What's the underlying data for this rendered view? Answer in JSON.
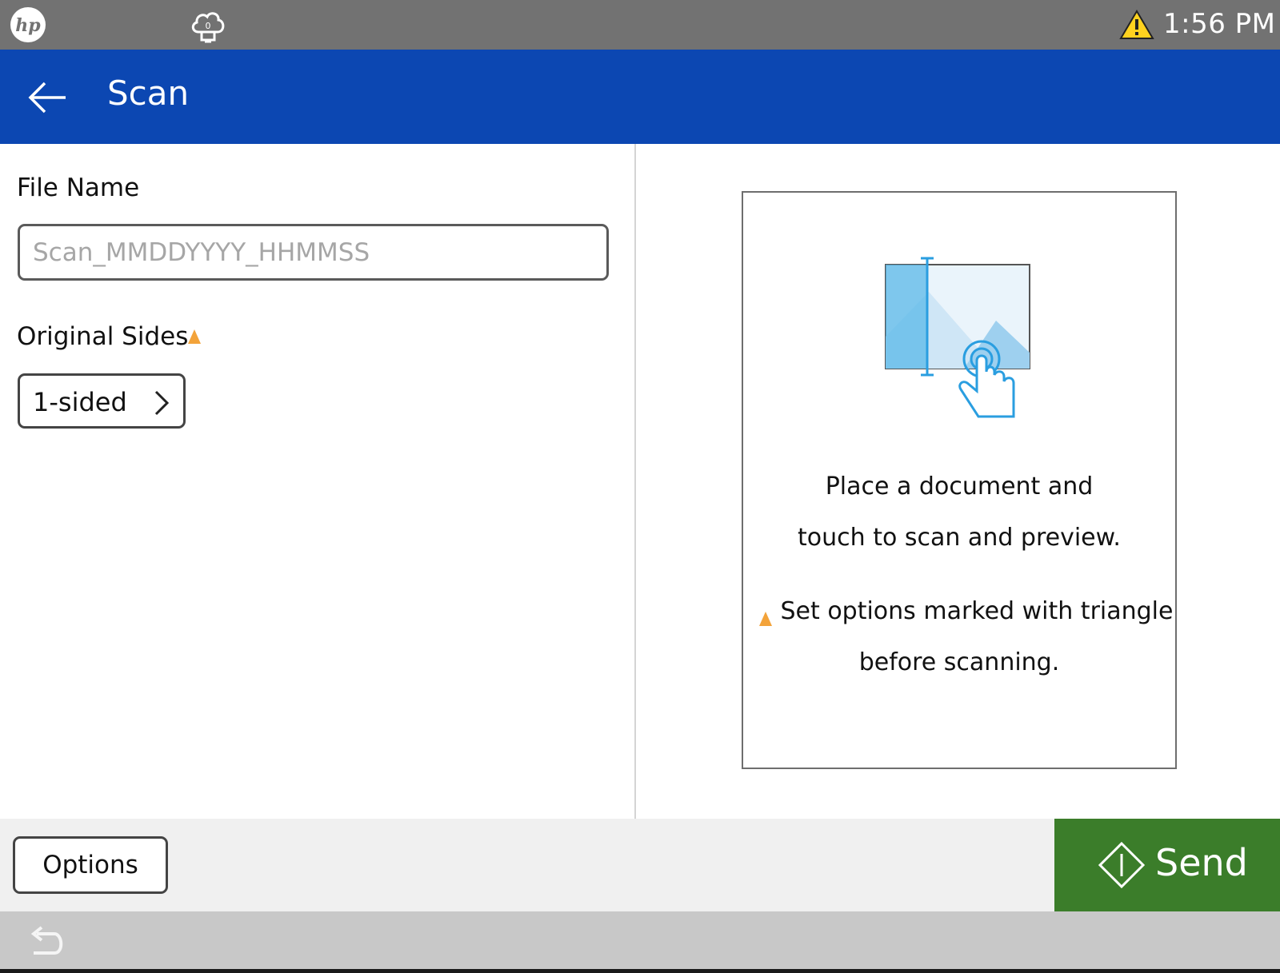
{
  "status_bar": {
    "clock": "1:56 PM",
    "icons": [
      "hp-logo",
      "cloud-icon",
      "warning-icon"
    ],
    "cloud_count": "0"
  },
  "header": {
    "title": "Scan",
    "back_icon": "arrow-left-icon"
  },
  "form": {
    "file_name": {
      "label": "File Name",
      "value": "",
      "placeholder": "Scan_MMDDYYYY_HHMMSS"
    },
    "original_sides": {
      "label": "Original Sides",
      "value": "1-sided",
      "icon": "chevron-right-icon"
    }
  },
  "preview": {
    "message_line1": "Place a document and",
    "message_line2": "touch to scan and preview.",
    "note_line1": "Set options marked with triangle",
    "note_line2": "before scanning."
  },
  "footer": {
    "options_label": "Options",
    "send_label": "Send",
    "send_icon": "diamond-start-icon"
  },
  "nav": {
    "back_icon": "return-arrow-icon"
  },
  "colors": {
    "header_blue": "#0c47b2",
    "status_gray": "#727272",
    "send_green": "#3b7d2a",
    "warning_orange": "#f3a33a",
    "preview_blue": "#5ab8e8"
  }
}
